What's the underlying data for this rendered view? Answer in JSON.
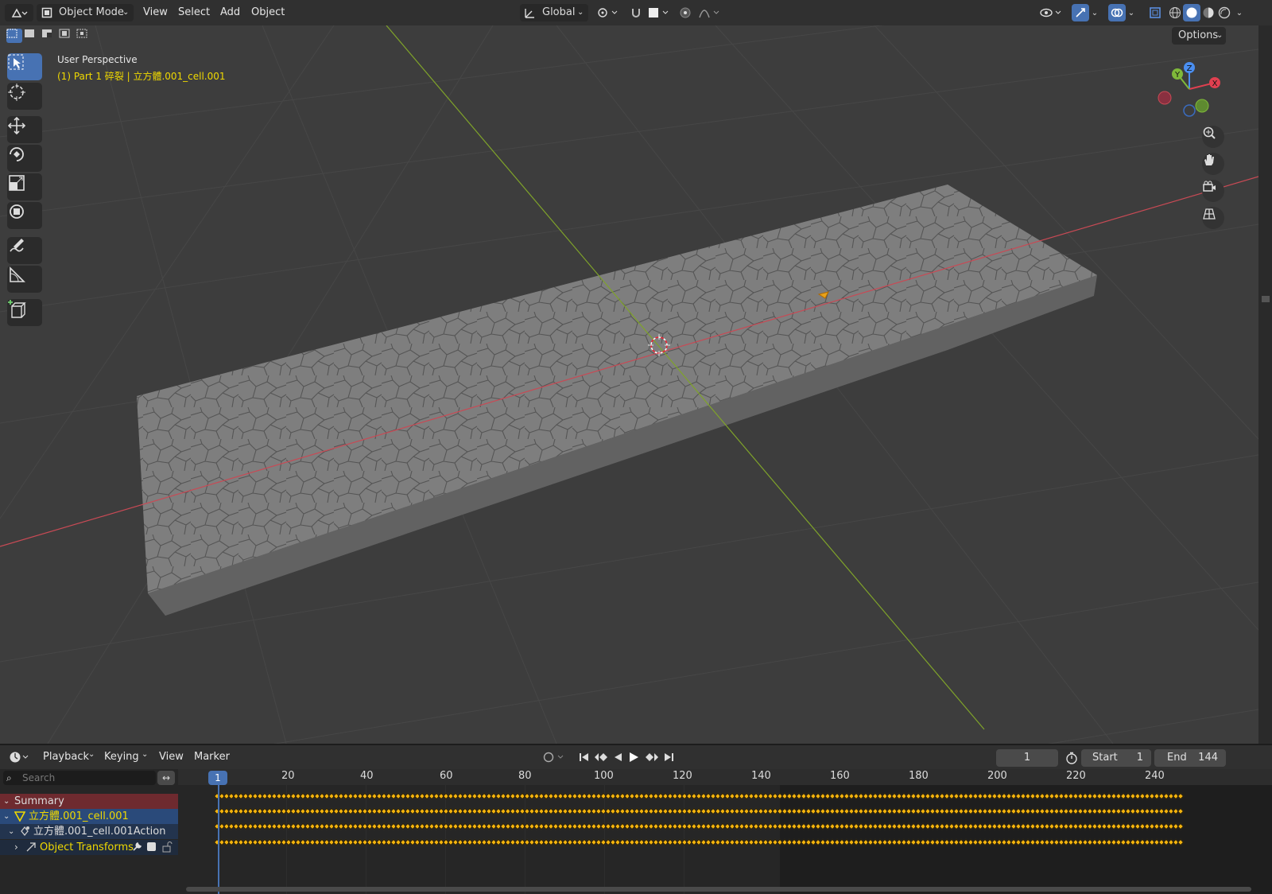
{
  "header": {
    "mode_label": "Object Mode",
    "menu": [
      "View",
      "Select",
      "Add",
      "Object"
    ],
    "transform_orientation": "Global",
    "options_label": "Options"
  },
  "viewport": {
    "perspective_label": "User Perspective",
    "object_label": "(1) Part 1 碎裂 | 立方體.001_cell.001",
    "gizmo": {
      "x": "X",
      "y": "Y",
      "z": "Z"
    }
  },
  "timeline": {
    "menu": [
      "Playback",
      "Keying",
      "View",
      "Marker"
    ],
    "current_frame": "1",
    "start_label": "Start",
    "start_value": "1",
    "end_label": "End",
    "end_value": "144",
    "search_placeholder": "Search",
    "frame_indicator": "1",
    "ruler": [
      "20",
      "40",
      "60",
      "80",
      "100",
      "120",
      "140",
      "160",
      "180",
      "200",
      "220",
      "240"
    ],
    "channels": {
      "summary": "Summary",
      "object": "立方體.001_cell.001",
      "action": "立方體.001_cell.001Action",
      "group": "Object Transforms"
    }
  },
  "colors": {
    "accent": "#4772b3",
    "keyframe": "#f2b20d",
    "summary_bg": "#6e2a2f",
    "object_bg": "#2a4a7a",
    "x_axis": "#c84a55",
    "y_axis": "#7fa32a",
    "object_text": "#f0d900"
  }
}
